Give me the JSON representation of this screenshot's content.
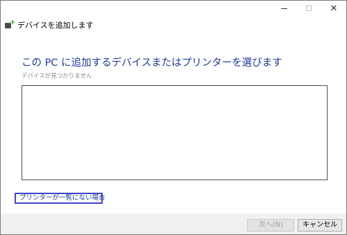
{
  "window": {
    "title": "デバイスを追加します",
    "controls": {
      "minimize": "—",
      "maximize": "□",
      "close": "✕"
    }
  },
  "main": {
    "heading": "この PC に追加するデバイスまたはプリンターを選びます",
    "status": "デバイスが見つかりません",
    "device_list": [],
    "not_listed_link": "プリンターが一覧にない場合"
  },
  "footer": {
    "next_label": "次へ(N)",
    "cancel_label": "キャンセル"
  },
  "icons": {
    "wizard_icon": "add-device-icon"
  },
  "colors": {
    "heading": "#1e3c9c",
    "link_focus_border": "#3f44c9",
    "footer_bg": "#f0f0f0"
  }
}
